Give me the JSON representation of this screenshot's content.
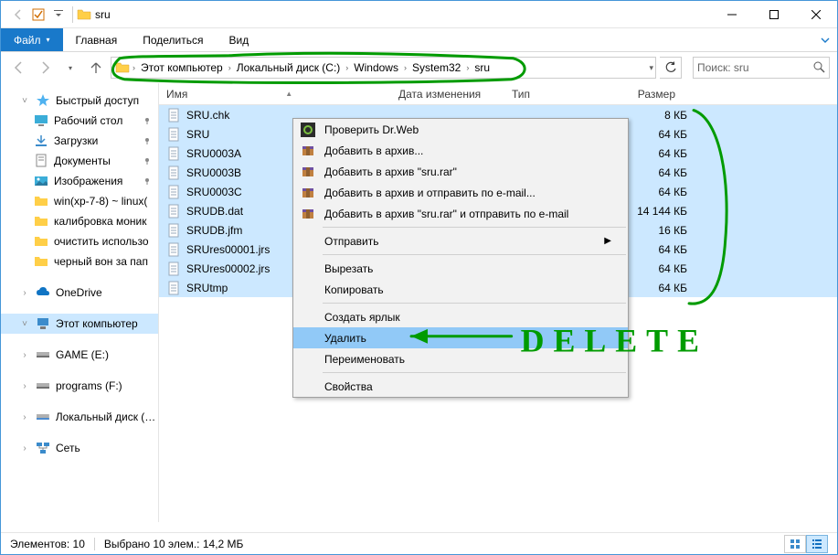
{
  "title": "sru",
  "ribbon": {
    "file": "Файл",
    "home": "Главная",
    "share": "Поделиться",
    "view": "Вид"
  },
  "breadcrumbs": [
    "Этот компьютер",
    "Локальный диск (C:)",
    "Windows",
    "System32",
    "sru"
  ],
  "search_placeholder": "Поиск: sru",
  "columns": {
    "name": "Имя",
    "date": "Дата изменения",
    "type": "Тип",
    "size": "Размер"
  },
  "nav": {
    "quick": "Быстрый доступ",
    "desktop": "Рабочий стол",
    "downloads": "Загрузки",
    "documents": "Документы",
    "pictures": "Изображения",
    "winxp": "win(xp-7-8) ~ linux(",
    "kalib": "калибровка моник",
    "clear": "очистить использо",
    "black": "черный вон за пап",
    "onedrive": "OneDrive",
    "thispc": "Этот компьютер",
    "game": "GAME (E:)",
    "programs": "programs (F:)",
    "localc": "Локальный диск (C:)",
    "network": "Сеть"
  },
  "files": [
    {
      "name": "SRU.chk",
      "size": "8 КБ"
    },
    {
      "name": "SRU",
      "size": "64 КБ"
    },
    {
      "name": "SRU0003A",
      "size": "64 КБ"
    },
    {
      "name": "SRU0003B",
      "size": "64 КБ"
    },
    {
      "name": "SRU0003C",
      "size": "64 КБ"
    },
    {
      "name": "SRUDB.dat",
      "size": "14 144 КБ"
    },
    {
      "name": "SRUDB.jfm",
      "size": "16 КБ"
    },
    {
      "name": "SRUres00001.jrs",
      "size": "64 КБ"
    },
    {
      "name": "SRUres00002.jrs",
      "size": "64 КБ"
    },
    {
      "name": "SRUtmp",
      "size": "64 КБ"
    }
  ],
  "ctx": {
    "drweb": "Проверить Dr.Web",
    "addarc": "Добавить в архив...",
    "addsru": "Добавить в архив \"sru.rar\"",
    "addmail": "Добавить в архив и отправить по e-mail...",
    "addsrumail": "Добавить в архив \"sru.rar\" и отправить по e-mail",
    "send": "Отправить",
    "cut": "Вырезать",
    "copy": "Копировать",
    "shortcut": "Создать ярлык",
    "delete": "Удалить",
    "rename": "Переименовать",
    "props": "Свойства"
  },
  "status": {
    "count": "Элементов: 10",
    "sel": "Выбрано 10 элем.: 14,2 МБ"
  },
  "annotation_text": "DELETE"
}
